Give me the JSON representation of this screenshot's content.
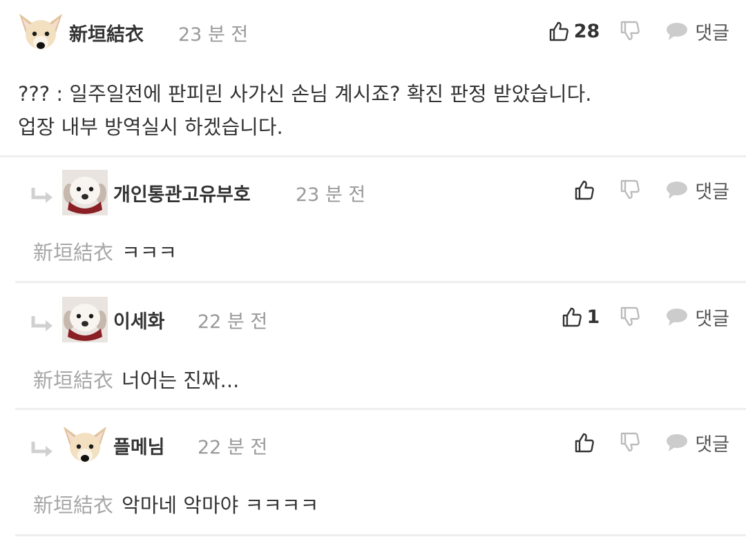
{
  "action_labels": {
    "reply": "댓글"
  },
  "colors": {
    "divider": "#eeeeee",
    "mention": "#a6a6a6",
    "meta": "#999999",
    "icon": "#333333",
    "icon_muted": "#bbbbbb"
  },
  "comments": [
    {
      "username": "新垣結衣",
      "time": "23 분 전",
      "likes": "28",
      "avatar_icon": "dog-face-icon",
      "lines": [
        "??? : 일주일전에 판피린 사가신 손님 계시죠? 확진 판정 받았습니다.",
        "업장 내부 방역실시 하겠습니다."
      ]
    },
    {
      "username": "개인통관고유부호",
      "time": "23 분 전",
      "likes": "",
      "avatar_icon": "puppy-face-icon",
      "mention": "新垣結衣",
      "text": "ㅋㅋㅋ"
    },
    {
      "username": "이세화",
      "time": "22 분 전",
      "likes": "1",
      "avatar_icon": "puppy-face-icon",
      "mention": "新垣結衣",
      "text": "너어는 진짜..."
    },
    {
      "username": "플메님",
      "time": "22 분 전",
      "likes": "",
      "avatar_icon": "dog-face-icon",
      "mention": "新垣結衣",
      "text": "악마네 악마야 ㅋㅋㅋㅋ"
    }
  ]
}
